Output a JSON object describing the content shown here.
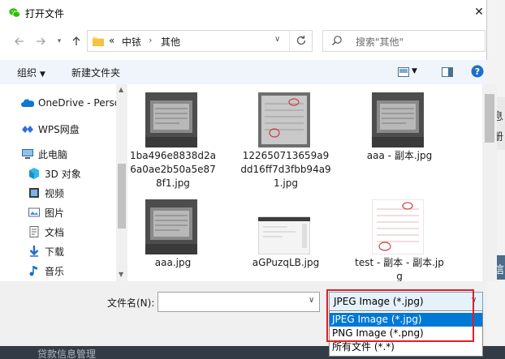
{
  "dialog": {
    "title": "打开文件",
    "close_glyph": "✕"
  },
  "address": {
    "overflow": "«",
    "crumbs": [
      "中铱",
      "其他"
    ],
    "sep": "›",
    "search_placeholder": "搜索\"其他\""
  },
  "toolbar": {
    "organize": "组织",
    "new_folder": "新建文件夹"
  },
  "nav": [
    {
      "label": "OneDrive - Perso",
      "icon": "onedrive-icon"
    },
    {
      "label": "WPS网盘",
      "icon": "wps-cloud-icon"
    },
    {
      "label": "此电脑",
      "icon": "computer-icon"
    },
    {
      "label": "3D 对象",
      "icon": "3d-objects-icon"
    },
    {
      "label": "视频",
      "icon": "video-icon"
    },
    {
      "label": "图片",
      "icon": "pictures-icon"
    },
    {
      "label": "文档",
      "icon": "documents-icon"
    },
    {
      "label": "下载",
      "icon": "download-icon"
    },
    {
      "label": "音乐",
      "icon": "music-icon"
    }
  ],
  "files": [
    {
      "name": "1ba496e8838d2a6a0ae2b50a5e878f1.jpg",
      "kind": "dark-photo"
    },
    {
      "name": "122650713659a9dd16ff7d3fbb94a91.jpg",
      "kind": "invoice-photo"
    },
    {
      "name": "aaa - 副本.jpg",
      "kind": "dark-photo"
    },
    {
      "name": "aaa.jpg",
      "kind": "dark-photo"
    },
    {
      "name": "aGPuzqLB.jpg",
      "kind": "screenshot"
    },
    {
      "name": "test - 副本 - 副本.jpg",
      "kind": "invoice-white"
    }
  ],
  "bottom": {
    "filename_label": "文件名(N):",
    "filename_value": "",
    "filetype_selected": "JPEG Image (*.jpg)",
    "filetype_options": [
      {
        "label": "JPEG Image (*.jpg)",
        "selected": true
      },
      {
        "label": "PNG Image (*.png)",
        "selected": false
      },
      {
        "label": "所有文件 (*.*)",
        "selected": false
      }
    ]
  },
  "background_app": {
    "text_1": "息",
    "text_2": "册",
    "text_3": "信",
    "bottom_text": "贷款信息管理"
  },
  "colors": {
    "toolbar_bg": "#f0f5fb",
    "selection": "#0078d7",
    "highlight_box": "#e31e24"
  }
}
